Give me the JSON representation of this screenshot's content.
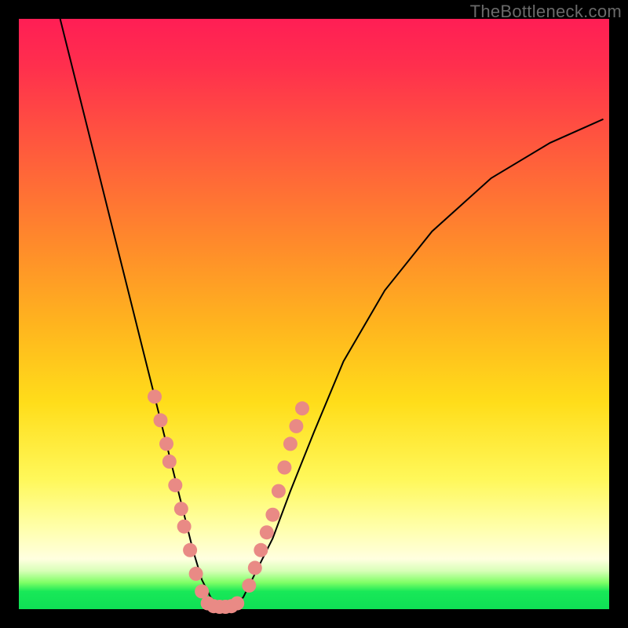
{
  "watermark": "TheBottleneck.com",
  "colors": {
    "dot": "#e98a85",
    "curve": "#000000"
  },
  "chart_data": {
    "type": "line",
    "title": "",
    "xlabel": "",
    "ylabel": "",
    "xlim": [
      0,
      100
    ],
    "ylim": [
      0,
      100
    ],
    "grid": false,
    "legend": false,
    "series": [
      {
        "name": "bottleneck-curve",
        "x": [
          7,
          10,
          13,
          16,
          19,
          21,
          23,
          25,
          26.5,
          28,
          29.5,
          31,
          32.5,
          34,
          36,
          38,
          40,
          43,
          46,
          50,
          55,
          62,
          70,
          80,
          90,
          99
        ],
        "y": [
          100,
          88,
          76,
          64,
          52,
          44,
          36,
          28,
          22,
          16,
          10,
          5,
          2,
          0.5,
          0.5,
          2,
          6,
          12,
          20,
          30,
          42,
          54,
          64,
          73,
          79,
          83
        ]
      }
    ],
    "annotations": {
      "dots_left": [
        {
          "x": 23,
          "y": 36
        },
        {
          "x": 24,
          "y": 32
        },
        {
          "x": 25,
          "y": 28
        },
        {
          "x": 25.5,
          "y": 25
        },
        {
          "x": 26.5,
          "y": 21
        },
        {
          "x": 27.5,
          "y": 17
        },
        {
          "x": 28,
          "y": 14
        },
        {
          "x": 29,
          "y": 10
        },
        {
          "x": 30,
          "y": 6
        },
        {
          "x": 31,
          "y": 3
        }
      ],
      "dots_right": [
        {
          "x": 39,
          "y": 4
        },
        {
          "x": 40,
          "y": 7
        },
        {
          "x": 41,
          "y": 10
        },
        {
          "x": 42,
          "y": 13
        },
        {
          "x": 43,
          "y": 16
        },
        {
          "x": 44,
          "y": 20
        },
        {
          "x": 45,
          "y": 24
        },
        {
          "x": 46,
          "y": 28
        },
        {
          "x": 47,
          "y": 31
        },
        {
          "x": 48,
          "y": 34
        }
      ],
      "dots_bottom": [
        {
          "x": 32,
          "y": 1
        },
        {
          "x": 33,
          "y": 0.5
        },
        {
          "x": 34,
          "y": 0.4
        },
        {
          "x": 35,
          "y": 0.4
        },
        {
          "x": 36,
          "y": 0.5
        },
        {
          "x": 37,
          "y": 1
        }
      ]
    }
  }
}
